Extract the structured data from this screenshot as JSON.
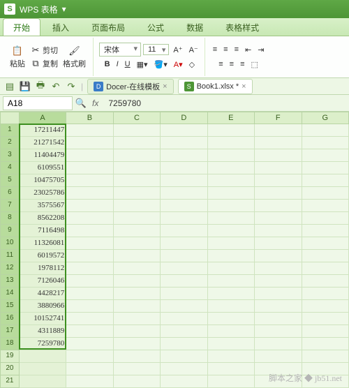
{
  "app": {
    "name": "WPS 表格",
    "logo": "S",
    "dropdown": "▾"
  },
  "tabs": [
    "开始",
    "插入",
    "页面布局",
    "公式",
    "数据",
    "表格样式"
  ],
  "active_tab": 0,
  "ribbon": {
    "paste": "粘贴",
    "cut": "剪切",
    "copy": "复制",
    "format_painter": "格式刷",
    "font_name": "宋体",
    "font_size": "11"
  },
  "doc_tabs": [
    {
      "icon": "D",
      "label": "Docer-在线模板",
      "close": "×",
      "active": false
    },
    {
      "icon": "S",
      "label": "Book1.xlsx *",
      "close": "×",
      "active": true
    }
  ],
  "formula": {
    "name_box": "A18",
    "fx": "fx",
    "value": "7259780"
  },
  "columns": [
    "A",
    "B",
    "C",
    "D",
    "E",
    "F",
    "G"
  ],
  "rows": 21,
  "data_col": "A",
  "values": [
    "17211447",
    "21271542",
    "11404479",
    "6109551",
    "10475705",
    "23025786",
    "3575567",
    "8562208",
    "7116498",
    "11326081",
    "6019572",
    "1978112",
    "7126046",
    "4428217",
    "3880966",
    "10152741",
    "4311889",
    "7259780"
  ],
  "selection": {
    "col": 0,
    "row_start": 0,
    "row_end": 17
  },
  "watermark": "脚本之家 ◆ jb51.net"
}
